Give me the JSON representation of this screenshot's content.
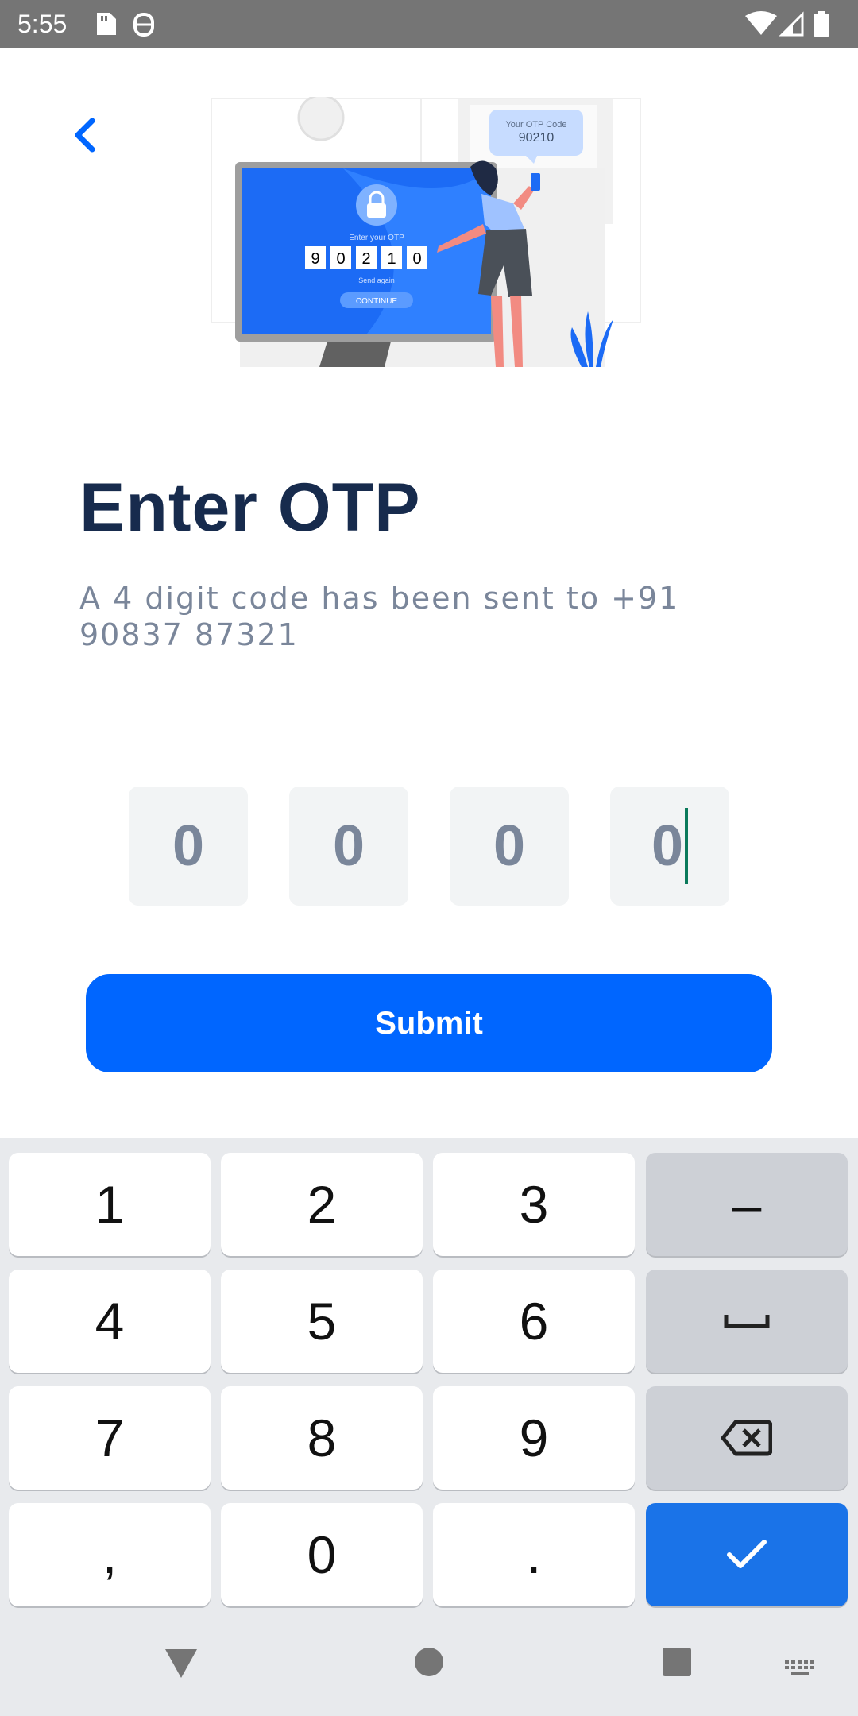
{
  "status_bar": {
    "time": "5:55",
    "icons": [
      "sd-card-icon",
      "android-debug-icon",
      "wifi-icon",
      "signal-icon",
      "battery-icon"
    ]
  },
  "header": {
    "back_icon": "chevron-left-icon"
  },
  "illustration": {
    "bubble_label": "Your OTP Code",
    "bubble_code": "90210",
    "screen_prompt": "Enter your OTP",
    "screen_digits": [
      "9",
      "0",
      "2",
      "1",
      "0"
    ],
    "screen_resend": "Send again",
    "screen_continue": "CONTINUE"
  },
  "page": {
    "title": "Enter OTP",
    "subtitle": "A 4 digit code has been sent to +91 90837 87321"
  },
  "otp": {
    "digits": [
      "0",
      "0",
      "0",
      "0"
    ]
  },
  "submit": {
    "label": "Submit"
  },
  "keyboard": {
    "row1": [
      "1",
      "2",
      "3",
      "–"
    ],
    "row2": [
      "4",
      "5",
      "6"
    ],
    "row3": [
      "7",
      "8",
      "9"
    ],
    "row4": [
      ",",
      "0",
      "."
    ],
    "space_icon": "space-bar-icon",
    "backspace_icon": "backspace-icon",
    "enter_icon": "check-icon"
  },
  "colors": {
    "primary": "#0066ff",
    "title": "#172b4d",
    "muted": "#7a869a",
    "otp_bg": "#f2f4f5",
    "keyboard_bg": "#e8eaed",
    "key_action": "#1a73e8"
  }
}
